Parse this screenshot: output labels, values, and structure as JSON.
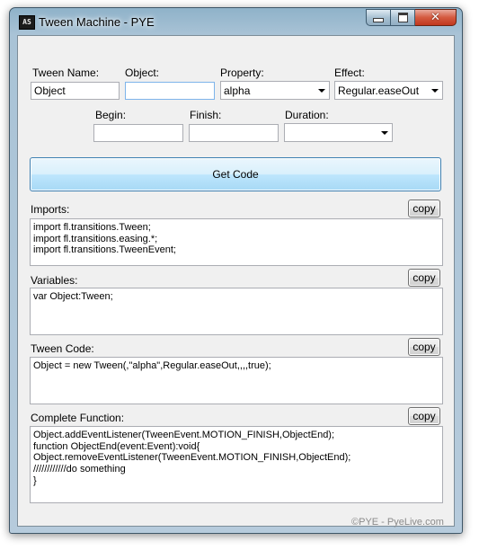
{
  "window": {
    "title": "Tween Machine  - PYE",
    "icon_text": "AS",
    "caption_buttons": [
      "minimize-icon",
      "maximize-icon",
      "close-icon"
    ],
    "close_glyph": "✕"
  },
  "form": {
    "tween_name": {
      "label": "Tween Name:",
      "value": "Object"
    },
    "object": {
      "label": "Object:",
      "value": ""
    },
    "property": {
      "label": "Property:",
      "value": "alpha"
    },
    "effect": {
      "label": "Effect:",
      "value": "Regular.easeOut"
    },
    "begin": {
      "label": "Begin:",
      "value": ""
    },
    "finish": {
      "label": "Finish:",
      "value": ""
    },
    "duration": {
      "label": "Duration:",
      "value": ""
    }
  },
  "get_code_label": "Get Code",
  "sections": {
    "imports": {
      "label": "Imports:",
      "copy_label": "copy",
      "text": "import fl.transitions.Tween;\nimport fl.transitions.easing.*;\nimport fl.transitions.TweenEvent;"
    },
    "variables": {
      "label": "Variables:",
      "copy_label": "copy",
      "text": "var Object:Tween;"
    },
    "tween_code": {
      "label": "Tween Code:",
      "copy_label": "copy",
      "text": "Object = new Tween(,\"alpha\",Regular.easeOut,,,,true);"
    },
    "complete_function": {
      "label": "Complete Function:",
      "copy_label": "copy",
      "text": "Object.addEventListener(TweenEvent.MOTION_FINISH,ObjectEnd);\nfunction ObjectEnd(event:Event):void{\nObject.removeEventListener(TweenEvent.MOTION_FINISH,ObjectEnd);\n////////////do something\n}"
    }
  },
  "footer": "©PYE - PyeLive.com"
}
